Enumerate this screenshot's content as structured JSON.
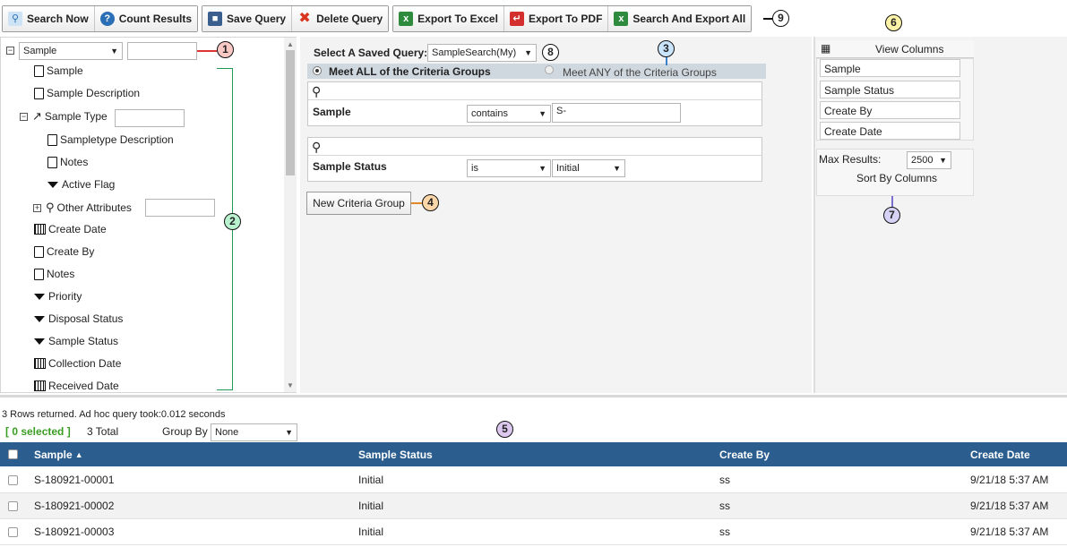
{
  "toolbar": {
    "search_now": "Search Now",
    "count_results": "Count Results",
    "save_query": "Save Query",
    "delete_query": "Delete Query",
    "export_excel": "Export To Excel",
    "export_pdf": "Export To PDF",
    "search_export_all": "Search And Export All"
  },
  "callouts": [
    "1",
    "2",
    "3",
    "4",
    "5",
    "6",
    "7",
    "8",
    "9"
  ],
  "tree": {
    "root_select": "Sample",
    "items": {
      "sample": "Sample",
      "sample_description": "Sample Description",
      "sample_type": "Sample Type",
      "sampletype_description": "Sampletype Description",
      "notes_sub": "Notes",
      "active_flag": "Active Flag",
      "other_attributes": "Other Attributes",
      "create_date": "Create Date",
      "create_by": "Create By",
      "notes": "Notes",
      "priority": "Priority",
      "disposal_status": "Disposal Status",
      "sample_status": "Sample Status",
      "collection_date": "Collection Date",
      "received_date": "Received Date"
    }
  },
  "query": {
    "saved_label": "Select A Saved Query:",
    "saved_value": "SampleSearch(My)",
    "meet_all": "Meet ALL of the Criteria Groups",
    "meet_any": "Meet ANY of the Criteria Groups",
    "groups": [
      {
        "field": "Sample",
        "operator": "contains",
        "value": "S-"
      },
      {
        "field": "Sample Status",
        "operator": "is",
        "value": "Initial"
      }
    ],
    "new_group": "New Criteria Group"
  },
  "columns": {
    "title": "View Columns",
    "list": [
      "Sample",
      "Sample Status",
      "Create By",
      "Create Date"
    ],
    "max_results_label": "Max Results:",
    "max_results_value": "2500",
    "sort_by": "Sort By Columns"
  },
  "results": {
    "summary": "3 Rows returned. Ad hoc query took:0.012 seconds",
    "selected": "[ 0 selected ]",
    "total": "3 Total",
    "group_by_label": "Group By",
    "group_by_value": "None",
    "headers": [
      "Sample",
      "Sample Status",
      "Create By",
      "Create Date"
    ],
    "sort_arrow": "▲",
    "rows": [
      [
        "S-180921-00001",
        "Initial",
        "ss",
        "9/21/18 5:37 AM"
      ],
      [
        "S-180921-00002",
        "Initial",
        "ss",
        "9/21/18 5:37 AM"
      ],
      [
        "S-180921-00003",
        "Initial",
        "ss",
        "9/21/18 5:37 AM"
      ]
    ]
  },
  "colors": {
    "header_blue": "#2b5d8e",
    "callout_red": "#f8c9c4",
    "callout_green": "#b9f2cf",
    "callout_blue": "#c9e4fb",
    "callout_orange": "#fbd6a8",
    "callout_purple": "#dcc7ef",
    "callout_yellow": "#fbf3a8",
    "callout_lavender": "#d6d2f5",
    "selected_green": "#3a9d23"
  }
}
